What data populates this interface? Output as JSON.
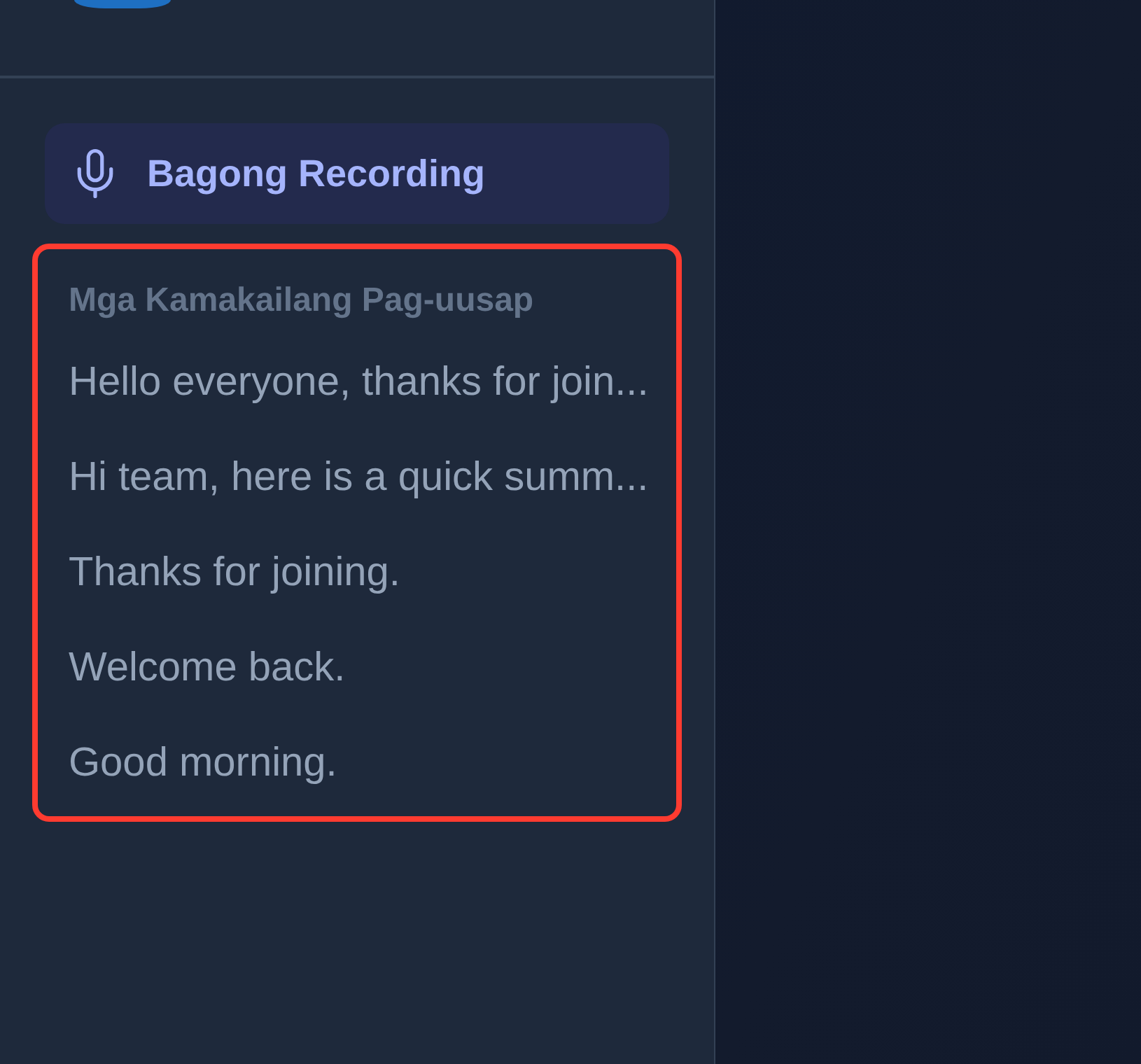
{
  "sidebar": {
    "new_recording_button": {
      "label": "Bagong Recording"
    },
    "recent_conversations": {
      "title": "Mga Kamakailang Pag-uusap",
      "highlighted": true,
      "items": [
        {
          "label": "Hello everyone, thanks for join..."
        },
        {
          "label": "Hi team, here is a quick summ..."
        },
        {
          "label": "Thanks for joining."
        },
        {
          "label": "Welcome back."
        },
        {
          "label": "Good morning."
        }
      ]
    }
  }
}
